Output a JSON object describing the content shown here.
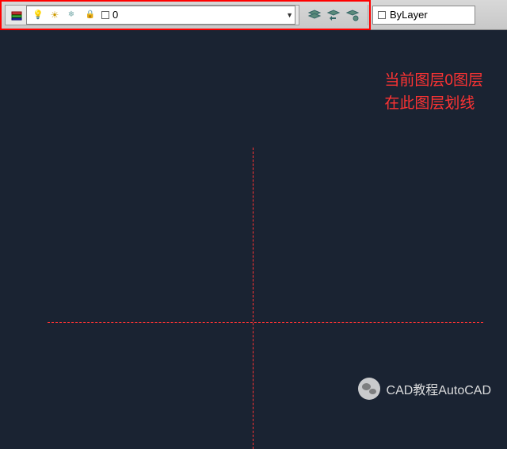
{
  "toolbar": {
    "layer_dropdown": {
      "current_layer": "0"
    },
    "bylayer": {
      "label": "ByLayer"
    }
  },
  "annotation": {
    "line1": "当前图层0图层",
    "line2": "在此图层划线"
  },
  "watermark": {
    "text": "CAD教程AutoCAD"
  }
}
